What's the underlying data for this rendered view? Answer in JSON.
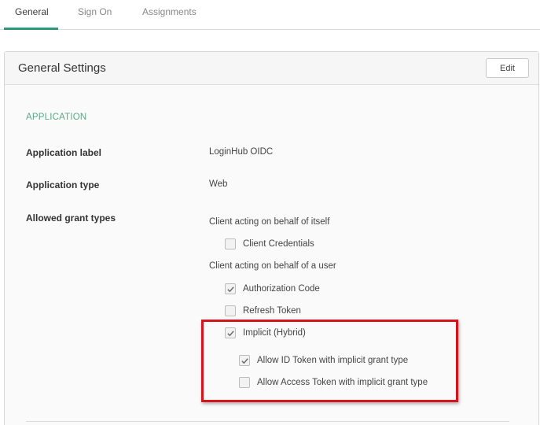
{
  "tabs": [
    {
      "label": "General"
    },
    {
      "label": "Sign On"
    },
    {
      "label": "Assignments"
    }
  ],
  "panel": {
    "title": "General Settings",
    "edit_label": "Edit"
  },
  "section": {
    "title": "APPLICATION"
  },
  "fields": {
    "app_label": {
      "label": "Application label",
      "value": "LoginHub OIDC"
    },
    "app_type": {
      "label": "Application type",
      "value": "Web"
    },
    "grant_types": {
      "label": "Allowed grant types"
    }
  },
  "grants": {
    "self_heading": "Client acting on behalf of itself",
    "client_credentials": {
      "label": "Client Credentials",
      "checked": false
    },
    "user_heading": "Client acting on behalf of a user",
    "authorization_code": {
      "label": "Authorization Code",
      "checked": true
    },
    "refresh_token": {
      "label": "Refresh Token",
      "checked": false
    },
    "implicit": {
      "label": "Implicit (Hybrid)",
      "checked": true
    },
    "allow_id_token": {
      "label": "Allow ID Token with implicit grant type",
      "checked": true
    },
    "allow_access_token": {
      "label": "Allow Access Token with implicit grant type",
      "checked": false
    }
  },
  "colors": {
    "accent": "#2a9a7a",
    "section_title": "#5aa98a",
    "highlight": "#d4161c"
  }
}
